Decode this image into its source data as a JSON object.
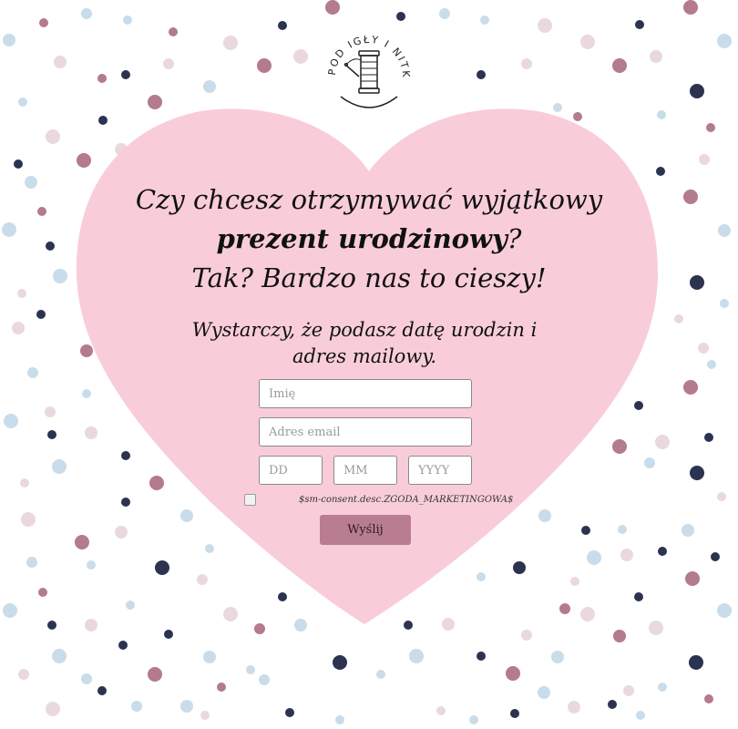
{
  "brand": {
    "name": "SPOD IGŁY I NITKI",
    "logo_icon": "needle-and-thread-spool-icon"
  },
  "headline": {
    "line1": "Czy chcesz otrzymywać wyjątkowy",
    "line2_bold": "prezent urodzinowy",
    "line2_rest": "?",
    "line3": "Tak? Bardzo nas to cieszy!"
  },
  "subtext": {
    "line1": "Wystarczy, że podasz datę urodzin i",
    "line2": "adres mailowy."
  },
  "form": {
    "name_placeholder": "Imię",
    "email_placeholder": "Adres email",
    "day_placeholder": "DD",
    "month_placeholder": "MM",
    "year_placeholder": "YYYY",
    "consent_label": "$sm-consent.desc.ZGODA_MARKETINGOWA$",
    "submit_label": "Wyślij"
  },
  "colors": {
    "heart": "#f8cdd9",
    "button": "#b97d91",
    "dot_navy": "#2b3350",
    "dot_mauve": "#b47a8e",
    "dot_lightblue": "#c9dcea",
    "dot_blush": "#ead9dc"
  }
}
